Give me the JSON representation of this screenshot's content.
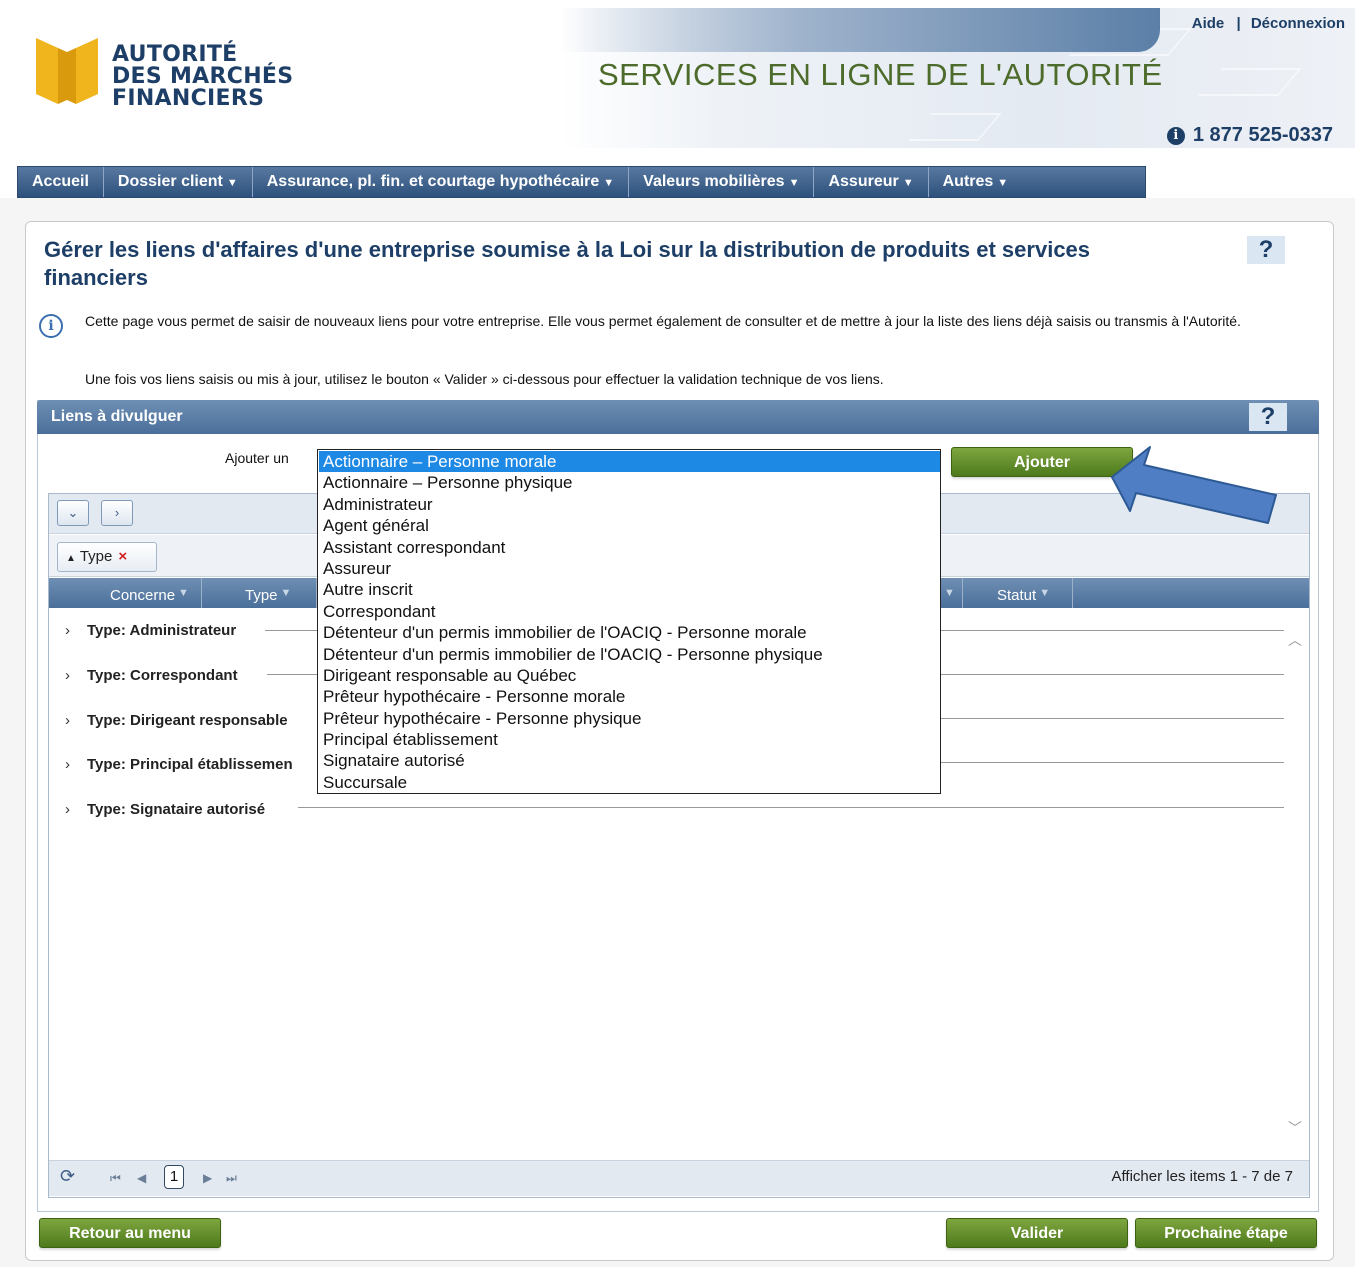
{
  "header": {
    "logo_lines": [
      "AUTORITÉ",
      "DES MARCHÉS",
      "FINANCIERS"
    ],
    "links": {
      "help": "Aide",
      "separator": "|",
      "logout": "Déconnexion"
    },
    "site_title": "SERVICES EN LIGNE DE L'AUTORITÉ",
    "phone": "1 877 525-0337"
  },
  "nav": {
    "items": [
      {
        "label": "Accueil",
        "has_menu": false
      },
      {
        "label": "Dossier client",
        "has_menu": true
      },
      {
        "label": "Assurance, pl. fin. et courtage hypothécaire",
        "has_menu": true
      },
      {
        "label": "Valeurs mobilières",
        "has_menu": true
      },
      {
        "label": "Assureur",
        "has_menu": true
      },
      {
        "label": "Autres",
        "has_menu": true
      }
    ]
  },
  "page": {
    "title": "Gérer les liens d'affaires d'une entreprise soumise à la Loi sur la distribution de produits et services financiers",
    "help": "?",
    "info_text": "Cette page vous permet de saisir de nouveaux liens pour votre entreprise. Elle vous permet également de consulter et de mettre à jour la liste des liens déjà saisis ou transmis à l'Autorité.",
    "info_text2": "Une fois vos liens saisis ou mis à jour, utilisez le bouton « Valider » ci-dessous pour effectuer la validation technique de vos liens."
  },
  "section": {
    "title": "Liens à divulguer",
    "help": "?",
    "add_label": "Ajouter un",
    "add_button": "Ajouter",
    "dropdown_options": [
      "Actionnaire – Personne morale",
      "Actionnaire – Personne physique",
      "Administrateur",
      "Agent général",
      "Assistant correspondant",
      "Assureur",
      "Autre inscrit",
      "Correspondant",
      "Détenteur d'un permis immobilier de l'OACIQ - Personne morale",
      "Détenteur d'un permis immobilier de l'OACIQ - Personne physique",
      "Dirigeant responsable au Québec",
      "Prêteur hypothécaire - Personne morale",
      "Prêteur hypothécaire - Personne physique",
      "Principal établissement",
      "Signataire autorisé",
      "Succursale"
    ],
    "selected_option": "Actionnaire – Personne morale"
  },
  "grid": {
    "group_chip": "Type",
    "columns": [
      "Concerne",
      "Type",
      "Statut"
    ],
    "groups": [
      "Type: Administrateur",
      "Type: Correspondant",
      "Type: Dirigeant responsable",
      "Type: Principal établissemen",
      "Type: Signataire autorisé"
    ],
    "pager": {
      "page": "1",
      "info": "Afficher les items 1 - 7 de 7"
    }
  },
  "footer": {
    "back_button": "Retour au menu",
    "validate_button": "Valider",
    "next_button": "Prochaine étape"
  },
  "colors": {
    "brand_navy": "#1d3e66",
    "brand_green": "#4d6b2a",
    "button_green": "#5e8a26",
    "nav_blue": "#3d6188",
    "selection_blue": "#1e88e5",
    "annotation_arrow": "#4472c4"
  }
}
